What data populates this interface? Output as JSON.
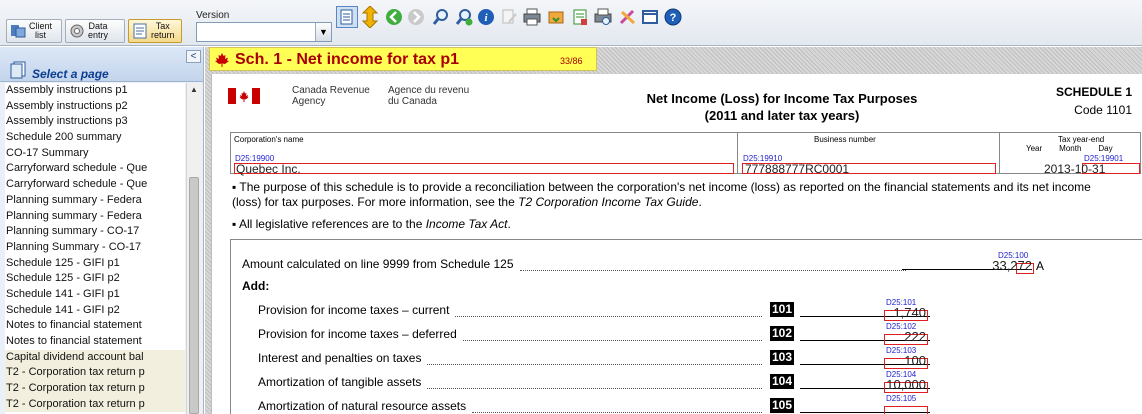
{
  "toolbar": {
    "client_list": [
      "Client",
      "list"
    ],
    "data_entry": [
      "Data",
      "entry"
    ],
    "tax_return": [
      "Tax",
      "return"
    ],
    "version_label": "Version",
    "version_value": "",
    "icons": [
      "form-view-icon",
      "navigate-updown-icon",
      "back-arrow-icon",
      "forward-arrow-icon",
      "search-icon",
      "search-add-icon",
      "info-icon",
      "edit-note-icon",
      "print-icon",
      "export-icon",
      "report-icon",
      "print-preview-icon",
      "tools-icon",
      "window-icon",
      "help-icon"
    ]
  },
  "sidebar": {
    "title": "Select a page",
    "collapse": "<",
    "items": [
      "Assembly instructions p1",
      "Assembly instructions p2",
      "Assembly instructions p3",
      "Schedule 200 summary",
      "CO-17 Summary",
      "Carryforward schedule - Que",
      "Carryforward schedule - Que",
      "Planning summary - Federa",
      "Planning summary - Federa",
      "Planning summary - CO-17",
      "Planning Summary - CO-17",
      "Schedule 125 - GIFI p1",
      "Schedule 125 - GIFI p2",
      "Schedule 141 - GIFI p1",
      "Schedule 141 - GIFI p2",
      "Notes to financial statement",
      "Notes to financial statement",
      "Capital dividend account bal",
      "T2 - Corporation tax return p",
      "T2 - Corporation tax return p",
      "T2 - Corporation tax return p"
    ]
  },
  "page": {
    "title": "Sch. 1 - Net income for tax p1",
    "counter": "33/86"
  },
  "form": {
    "agency_en": [
      "Canada Revenue",
      "Agency"
    ],
    "agency_fr": [
      "Agence du revenu",
      "du Canada"
    ],
    "heading": [
      "Net Income (Loss) for Income Tax Purposes",
      "(2011 and later tax years)"
    ],
    "schedule": "SCHEDULE 1",
    "code": "Code 1101",
    "corp_name_label": "Corporation's name",
    "corp_name_tag": "D25:19900",
    "corp_name_value": "Quebec Inc.",
    "bn_label": "Business number",
    "bn_tag": "D25:19910",
    "bn_value": "777888777RC0001",
    "tye_label": "Tax year-end",
    "tye_sub": [
      "Year",
      "Month",
      "Day"
    ],
    "tye_tag": "D25:19901",
    "tye_value": "2013-10-31",
    "purpose": "The purpose of this schedule is to provide a reconciliation between the corporation's net income (loss) as reported on the financial statements and its net income (loss) for tax purposes. For more information, see the ",
    "purpose_guide": "T2 Corporation Income Tax Guide",
    "legislative": "All legislative references are to the ",
    "legislative_act": "Income Tax Act",
    "amount_label": "Amount calculated on line 9999 from Schedule 125",
    "amount_tag": "D25:100",
    "amount_value": "33,272",
    "amount_letter": "A",
    "add_label": "Add:",
    "lines": [
      {
        "label": "Provision for income taxes – current",
        "code": "101",
        "tag": "D25:101",
        "value": "1,740"
      },
      {
        "label": "Provision for income taxes – deferred",
        "code": "102",
        "tag": "D25:102",
        "value": "222"
      },
      {
        "label": "Interest and penalties on taxes",
        "code": "103",
        "tag": "D25:103",
        "value": "100"
      },
      {
        "label": "Amortization of tangible assets",
        "code": "104",
        "tag": "D25:104",
        "value": "10,000"
      },
      {
        "label": "Amortization of natural resource assets",
        "code": "105",
        "tag": "D25:105",
        "value": ""
      }
    ]
  }
}
